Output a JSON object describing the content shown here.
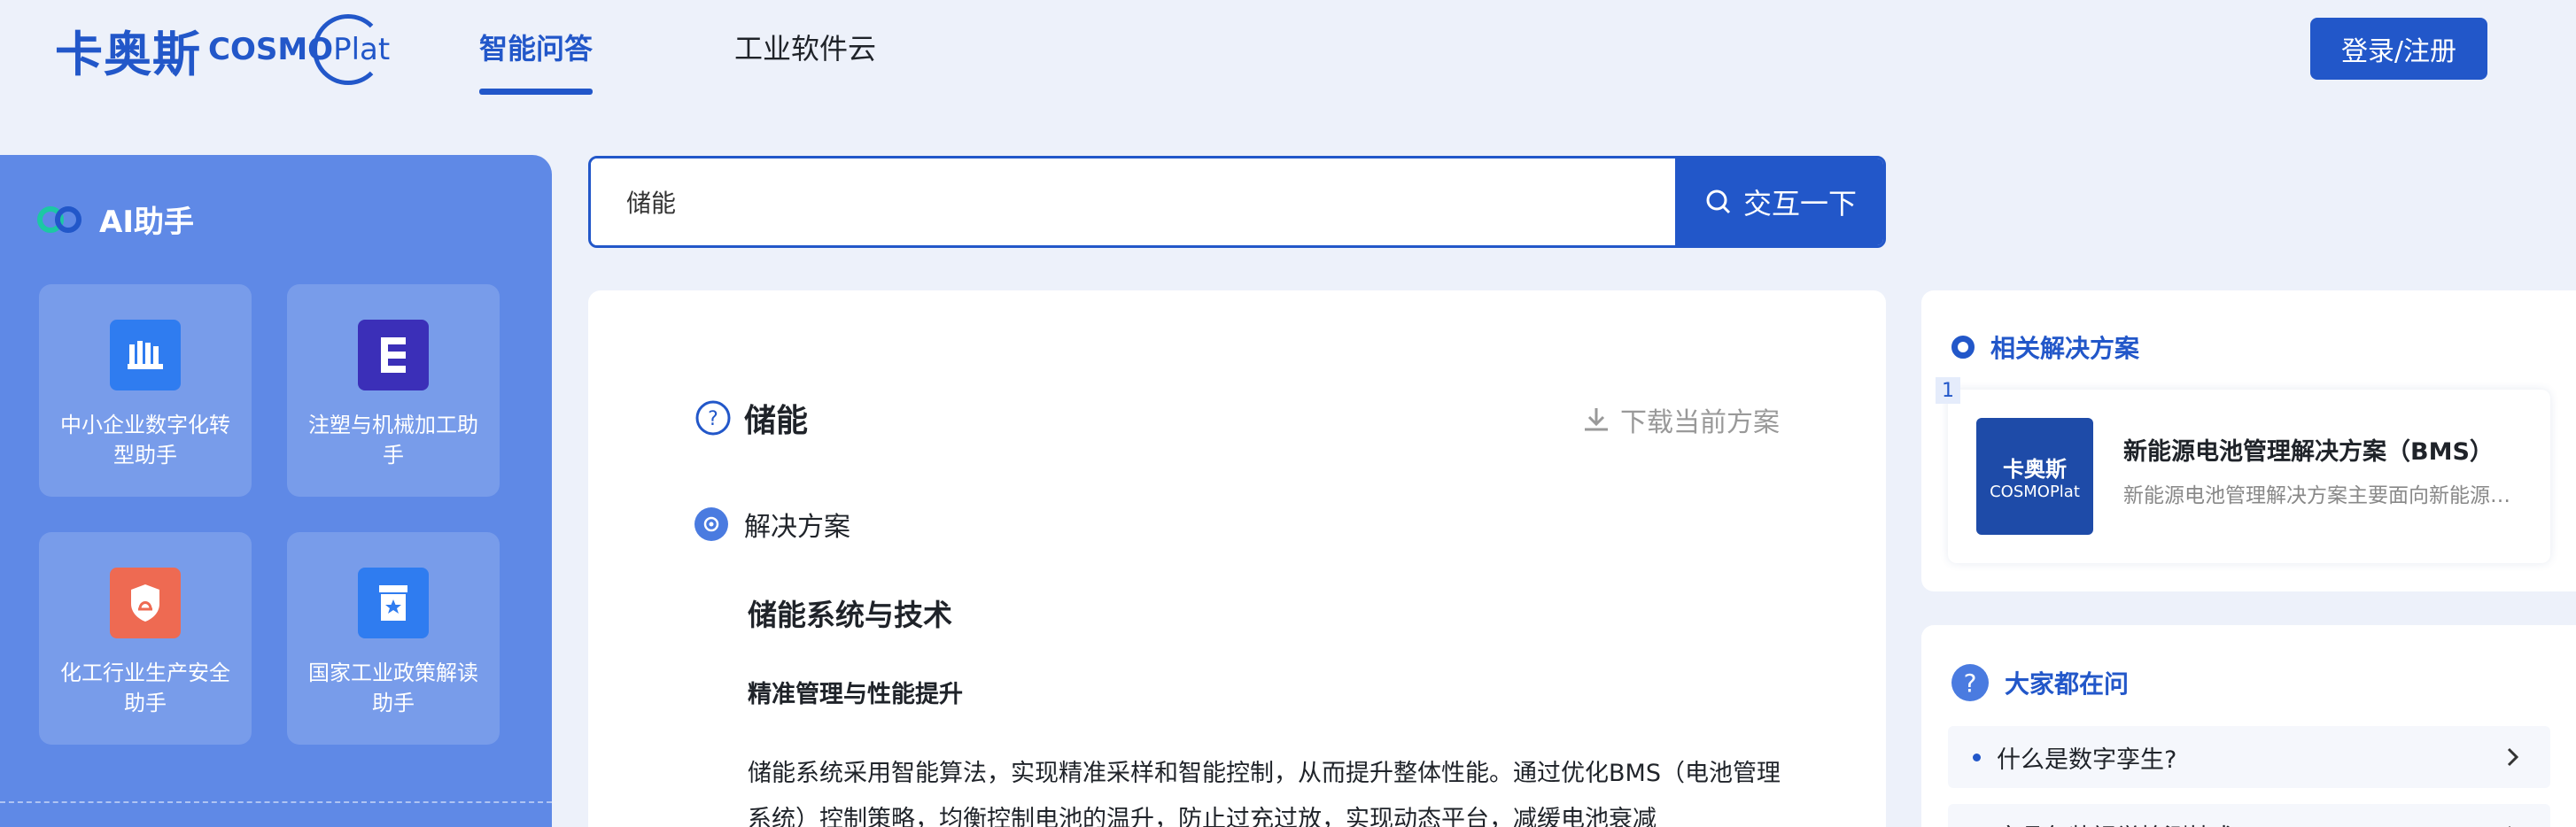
{
  "header": {
    "logo_cn": "卡奥斯",
    "logo_en_bold": "COSMO",
    "logo_en_light": "Plat",
    "tabs": [
      {
        "label": "智能问答",
        "active": true
      },
      {
        "label": "工业软件云",
        "active": false
      }
    ],
    "login_label": "登录/注册"
  },
  "sidebar": {
    "title": "AI助手",
    "cards": [
      {
        "label": "中小企业数字化转型助手",
        "icon": "factory-icon",
        "color": "#2f7cf0"
      },
      {
        "label": "注塑与机械加工助手",
        "icon": "machine-icon",
        "color": "#3b2fb8"
      },
      {
        "label": "化工行业生产安全助手",
        "icon": "safety-shield-icon",
        "color": "#ee6a52"
      },
      {
        "label": "国家工业政策解读助手",
        "icon": "policy-icon",
        "color": "#2f7cf0"
      }
    ]
  },
  "search": {
    "value": "储能",
    "button_label": "交互一下"
  },
  "answer": {
    "question": "储能",
    "download_label": "下载当前方案",
    "solution_label": "解决方案",
    "heading": "储能系统与技术",
    "subheading": "精准管理与性能提升",
    "paragraph": "储能系统采用智能算法，实现精准采样和智能控制，从而提升整体性能。通过优化BMS（电池管理系统）控制策略，均衡控制电池的温升，防止过充过放，实现动态平台，减缓电池衰减"
  },
  "related": {
    "title": "相关解决方案",
    "items": [
      {
        "index": "1",
        "thumb_cn": "卡奥斯",
        "thumb_en": "COSMOPlat",
        "name": "新能源电池管理解决方案（BMS）",
        "desc": "新能源电池管理解决方案主要面向新能源汽车及储能领域"
      }
    ]
  },
  "popular": {
    "title": "大家都在问",
    "questions": [
      "什么是数字孪生?",
      "产品包装视觉检测技术?"
    ]
  },
  "colors": {
    "primary": "#2257c9",
    "sidebar": "#5f89e6",
    "background": "#edf1fa"
  }
}
